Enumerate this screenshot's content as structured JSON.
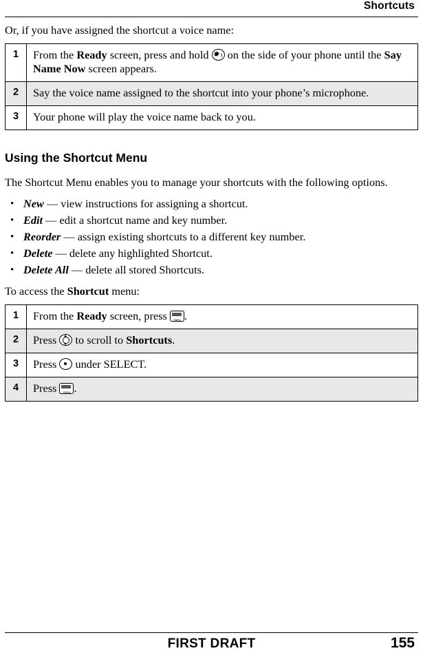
{
  "header": {
    "title": "Shortcuts"
  },
  "intro": {
    "text_before": "Or, if you have assigned the shortcut a voice name:"
  },
  "voice_name_table": {
    "rows": [
      {
        "num": "1",
        "parts": [
          {
            "t": "text",
            "v": "From the "
          },
          {
            "t": "bold",
            "v": "Ready"
          },
          {
            "t": "text",
            "v": " screen, press and hold "
          },
          {
            "t": "icon",
            "v": "volume-key-icon"
          },
          {
            "t": "text",
            "v": " on the side of your phone until the "
          },
          {
            "t": "bold",
            "v": "Say Name Now"
          },
          {
            "t": "text",
            "v": " screen appears."
          }
        ],
        "shaded": false
      },
      {
        "num": "2",
        "parts": [
          {
            "t": "text",
            "v": "Say the voice name assigned to the shortcut into your phone’s microphone."
          }
        ],
        "shaded": true
      },
      {
        "num": "3",
        "parts": [
          {
            "t": "text",
            "v": "Your phone will play the voice name back to you."
          }
        ],
        "shaded": false
      }
    ]
  },
  "section": {
    "heading": "Using the Shortcut Menu",
    "description": "The Shortcut Menu enables you to manage your shortcuts with the following options.",
    "bullets": [
      {
        "term": "New",
        "desc": " — view instructions for assigning a shortcut."
      },
      {
        "term": "Edit",
        "desc": " — edit a shortcut name and key number."
      },
      {
        "term": "Reorder",
        "desc": " — assign existing shortcuts to a different key number."
      },
      {
        "term": "Delete",
        "desc": " — delete any highlighted Shortcut."
      },
      {
        "term": "Delete All",
        "desc": " — delete all stored Shortcuts."
      }
    ]
  },
  "access_intro": {
    "before": "To access the ",
    "bold": "Shortcut",
    "after": " menu:"
  },
  "access_table": {
    "rows": [
      {
        "num": "1",
        "parts": [
          {
            "t": "text",
            "v": "From the "
          },
          {
            "t": "bold",
            "v": "Ready"
          },
          {
            "t": "text",
            "v": " screen, press "
          },
          {
            "t": "icon",
            "v": "menu-key-icon"
          },
          {
            "t": "text",
            "v": "."
          }
        ],
        "shaded": false
      },
      {
        "num": "2",
        "parts": [
          {
            "t": "text",
            "v": "Press "
          },
          {
            "t": "icon",
            "v": "navigation-key-icon"
          },
          {
            "t": "text",
            "v": " to scroll to "
          },
          {
            "t": "bold",
            "v": "Shortcuts"
          },
          {
            "t": "text",
            "v": "."
          }
        ],
        "shaded": true
      },
      {
        "num": "3",
        "parts": [
          {
            "t": "text",
            "v": "Press "
          },
          {
            "t": "icon",
            "v": "select-key-icon"
          },
          {
            "t": "text",
            "v": " under SELECT."
          }
        ],
        "shaded": false
      },
      {
        "num": "4",
        "parts": [
          {
            "t": "text",
            "v": "Press "
          },
          {
            "t": "icon",
            "v": "menu-key-icon"
          },
          {
            "t": "text",
            "v": "."
          }
        ],
        "shaded": true
      }
    ]
  },
  "footer": {
    "draft": "FIRST DRAFT",
    "page": "155"
  },
  "key_labels": {
    "menu": "menu"
  }
}
